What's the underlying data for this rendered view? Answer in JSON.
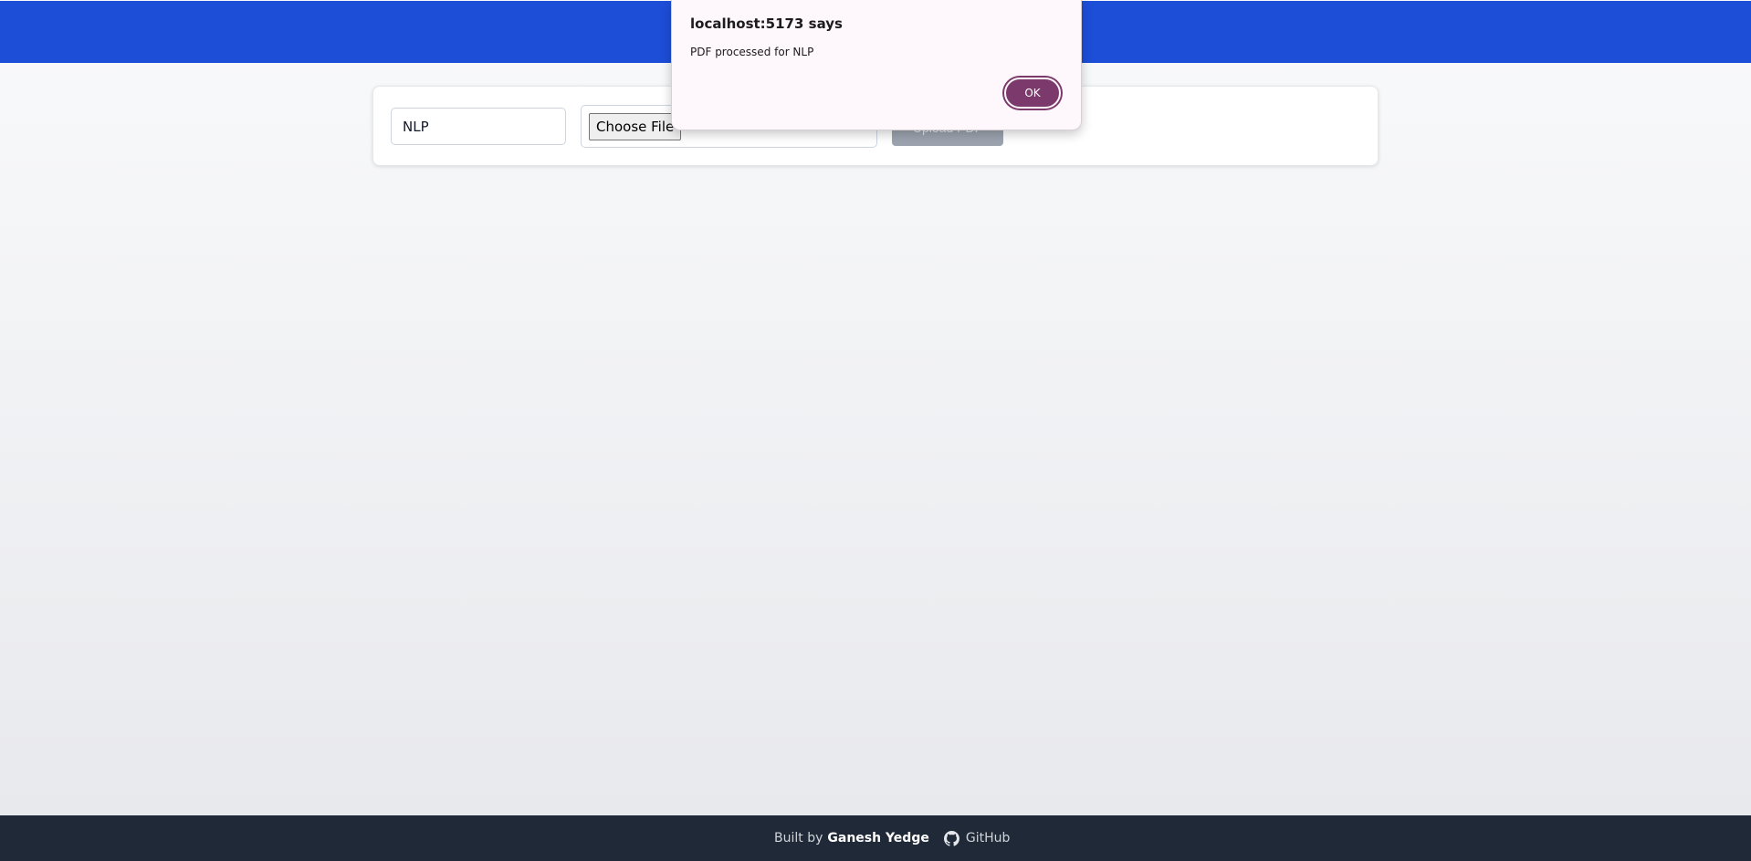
{
  "form": {
    "subject_value": "NLP",
    "file_button_label": "Choose File",
    "file_name": "",
    "upload_label": "Upload PDF"
  },
  "dialog": {
    "title": "localhost:5173 says",
    "message": "PDF processed for NLP",
    "ok_label": "OK"
  },
  "footer": {
    "built_by": "Built by",
    "author": "Ganesh Yedge",
    "github_label": "GitHub",
    "github_icon": "github-icon"
  },
  "colors": {
    "header": "#1d4ed8",
    "dialog_accent": "#7b3a6b",
    "footer": "#1f2937"
  }
}
